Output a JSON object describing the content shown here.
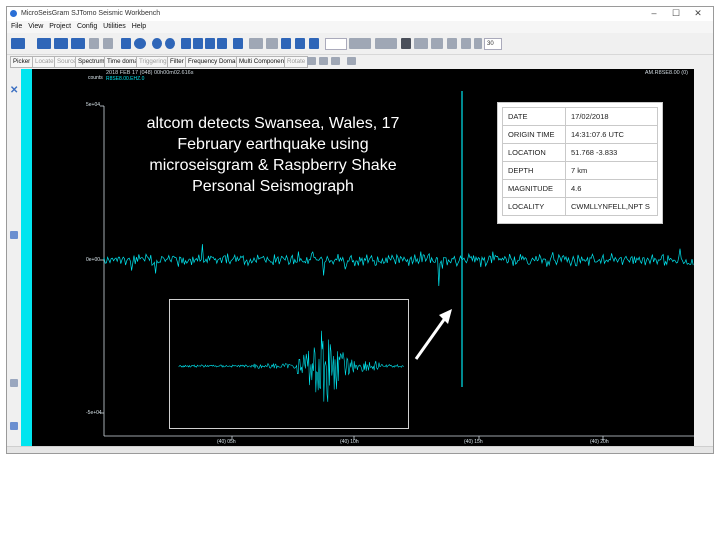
{
  "window": {
    "title": "MicroSeisGram SJTomo  Seismic Workbench",
    "controls": [
      "–",
      "☐",
      "✕"
    ]
  },
  "menu": [
    "File",
    "View",
    "Project",
    "Config",
    "Utilities",
    "Help"
  ],
  "toolbar": {
    "field1": "",
    "field2": "30"
  },
  "toolbar2": [
    {
      "label": "Picker",
      "disabled": false
    },
    {
      "label": "Locate",
      "disabled": true
    },
    {
      "label": "Source",
      "disabled": true
    },
    {
      "label": "Spectrum",
      "disabled": false
    },
    {
      "label": "Time domain",
      "disabled": false
    },
    {
      "label": "Triggering",
      "disabled": true
    },
    {
      "label": "Filter",
      "disabled": false
    },
    {
      "label": "Frequency Domain",
      "disabled": false
    },
    {
      "label": "Multi Component",
      "disabled": false
    },
    {
      "label": "Rotate",
      "disabled": true
    }
  ],
  "plot": {
    "header_left": "2018 FEB 17 (048) 00h00m02.616s",
    "header_right": "AM.R8SE8.00 (0)",
    "units": "counts",
    "channel": "R8SE8.00.EHZ.0",
    "y_ticks": [
      "5e+04",
      "0e+00",
      "-5e+04"
    ],
    "x_ticks": [
      "(40) 05h",
      "(40) 10h",
      "(40) 15h",
      "(40) 20h"
    ],
    "annotation": "altcom detects Swansea, Wales, 17 February earthquake using microseisgram & Raspberry Shake Personal Seismograph",
    "trace_color": "#00e5ef"
  },
  "event": {
    "rows": [
      {
        "key": "DATE",
        "value": "17/02/2018"
      },
      {
        "key": "ORIGIN TIME",
        "value": "14:31:07.6 UTC"
      },
      {
        "key": "LOCATION",
        "value": "51.768 -3.833"
      },
      {
        "key": "DEPTH",
        "value": "7 km"
      },
      {
        "key": "MAGNITUDE",
        "value": "4.6"
      },
      {
        "key": "LOCALITY",
        "value": "CWMLLYNFELL,NPT S"
      }
    ]
  }
}
